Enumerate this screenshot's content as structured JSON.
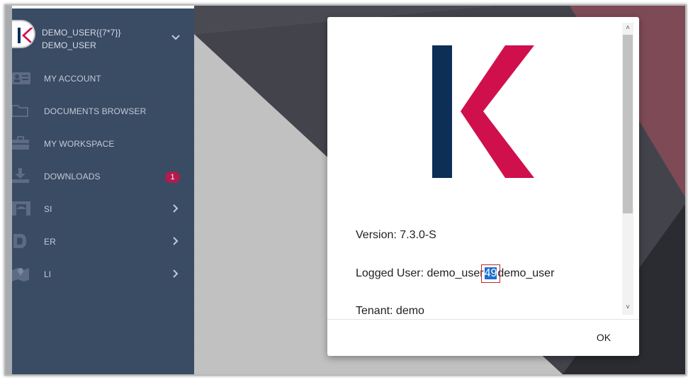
{
  "user": {
    "line1": "DEMO_USER{{7*7}}",
    "line2": "DEMO_USER"
  },
  "nav": {
    "items": [
      {
        "label": "MY ACCOUNT",
        "icon": "id-card-icon"
      },
      {
        "label": "DOCUMENTS BROWSER",
        "icon": "folder-icon"
      },
      {
        "label": "MY WORKSPACE",
        "icon": "briefcase-icon"
      },
      {
        "label": "DOWNLOADS",
        "icon": "download-icon",
        "badge": "1"
      },
      {
        "label": "SI",
        "icon": "building-icon"
      },
      {
        "label": "ER",
        "icon": "document-icon"
      },
      {
        "label": "LI",
        "icon": "map-icon"
      }
    ]
  },
  "dialog": {
    "version": "Version: 7.3.0-S",
    "logged_user_prefix": "Logged User: demo_user",
    "logged_user_highlight": "49",
    "logged_user_suffix": "demo_user",
    "tenant": "Tenant: demo",
    "ok_label": "OK"
  },
  "scroll": {
    "up_arrow": "˄",
    "down_arrow": "˅"
  },
  "colors": {
    "sidebar": "#3a4b64",
    "accent": "#d0104c",
    "logo_bar": "#0c2e57",
    "badge": "#b21b4d",
    "selection": "#1c6fd1"
  }
}
